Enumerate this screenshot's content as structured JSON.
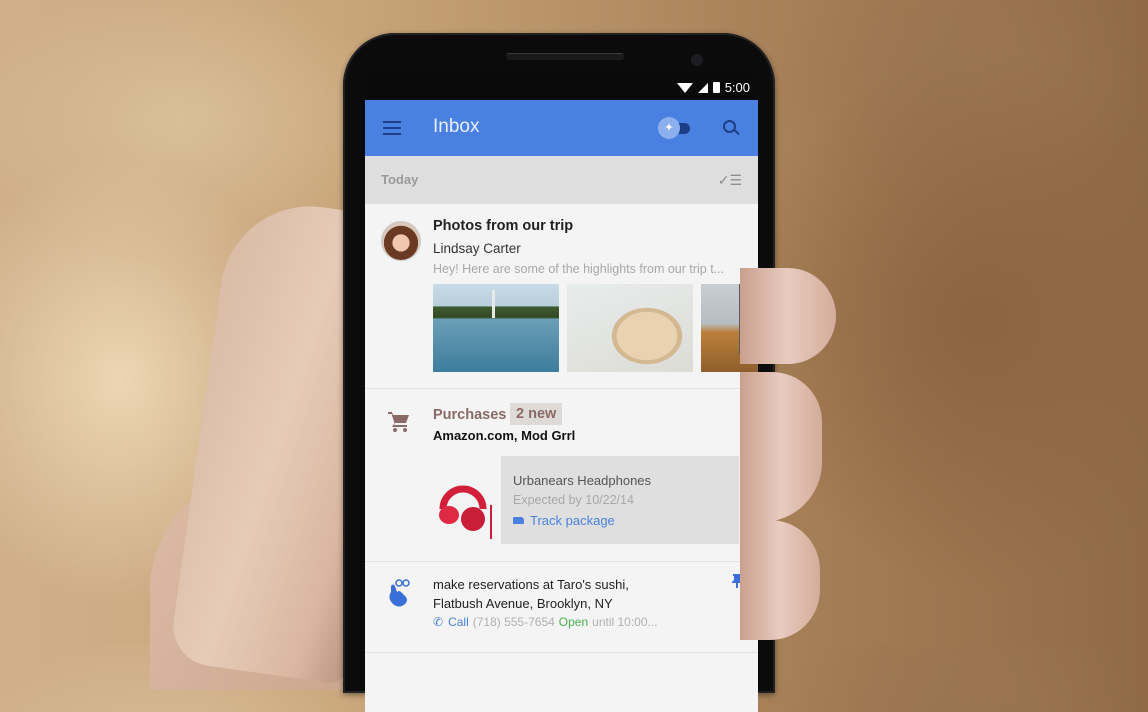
{
  "statusbar": {
    "time": "5:00",
    "icons": [
      "wifi-icon",
      "cell-signal-icon",
      "battery-icon"
    ]
  },
  "appbar": {
    "menu_icon": "menu-icon",
    "title": "Inbox",
    "pin_toggle_icon": "pin-icon",
    "pin_glyph": "✦",
    "search_icon": "search-icon"
  },
  "section": {
    "title": "Today",
    "sweep_glyph": "✓☰"
  },
  "emails": [
    {
      "subject": "Photos from our trip",
      "sender": "Lindsay Carter",
      "snippet": "Hey! Here are some of the highlights from our trip t...",
      "attachments": [
        "photo-monument-reflecting-pool",
        "photo-bagel-food",
        "photo-window-view"
      ]
    }
  ],
  "bundle": {
    "title": "Purchases",
    "badge": "2 new",
    "merchants": "Amazon.com, Mod Grrl",
    "product": {
      "name": "Urbanears Headphones",
      "eta": "Expected by 10/22/14",
      "action": "Track package"
    },
    "accent": "#8a6a66"
  },
  "reminder": {
    "text_line1": "make reservations at Taro's sushi,",
    "text_line2": "Flatbush Avenue, Brooklyn, NY",
    "call_label": "Call",
    "phone": "(718) 555-7654",
    "open_status": "Open",
    "hours": "until 10:00...",
    "pin_glyph": "📌"
  },
  "colors": {
    "appbar": "#4a80e0",
    "appbar_icons": "#1c3e86",
    "link": "#4a80e0",
    "open_green": "#4caf50"
  }
}
